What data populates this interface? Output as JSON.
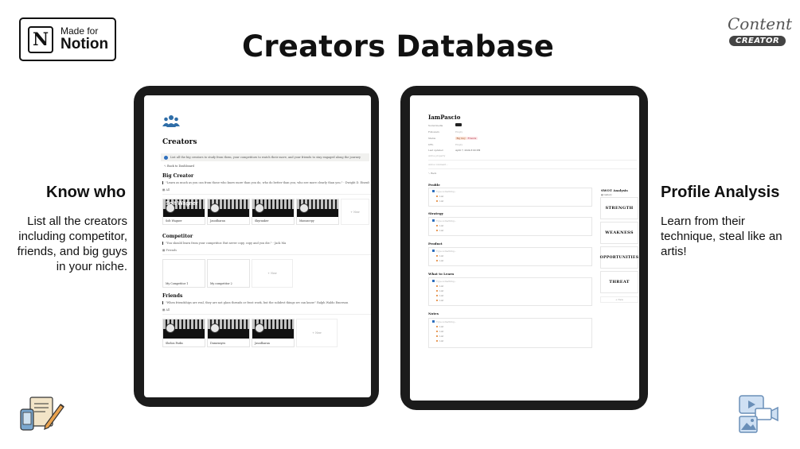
{
  "badge": {
    "small": "Made for",
    "big": "Notion",
    "logo_letter": "N"
  },
  "title": "Creators Database",
  "brand": {
    "script": "Content",
    "pill": "CREATOR"
  },
  "left_panel": {
    "heading": "Know who",
    "description": "List all the creators including competitor, friends, and big guys in your niche."
  },
  "right_panel": {
    "heading": "Profile Analysis",
    "description": "Learn from their technique, steal like an artis!"
  },
  "screen1": {
    "page_icon": "people-icon",
    "title": "Creators",
    "callout": "List all the big creators to study from them, your competitors to watch their move, and your friends to stay engaged along the journey",
    "back_link": "Back to Dashboard",
    "sections": [
      {
        "title": "Big Creator",
        "quote": "\"Learn as much as you can from those who know more than you do, who do better than you, who see more clearly than you.\" - Dwight D. Eisenhower",
        "view": "All",
        "cards": [
          "Solt Wagner",
          "Jasodharan",
          "Skyranker",
          "Manuscrpy"
        ],
        "card_overlay": "Solt Wagner",
        "new_label": "+ New"
      },
      {
        "title": "Competitor",
        "quote": "\"You should learn from your competitor. But never copy, copy and you die.\" - Jack Ma",
        "view": "Friends",
        "cards": [
          "My Competitor 1",
          "My competitor 2"
        ],
        "new_label": "+ New"
      },
      {
        "title": "Friends",
        "quote": "\"When friendships are real, they are not glass threads or frost work, but the solidest things we can know.\" Ralph Waldo Emerson",
        "view": "All",
        "cards": [
          "Shelon Parks",
          "Dumensyes",
          "Jasodharan"
        ],
        "new_label": "+ New"
      }
    ]
  },
  "screen2": {
    "title": "IamPascio",
    "properties": [
      {
        "label": "Social media",
        "value": ""
      },
      {
        "label": "Followers",
        "value": "Empty"
      },
      {
        "label": "Status",
        "value": ""
      },
      {
        "label": "URL",
        "value": "Empty"
      },
      {
        "label": "Last updated",
        "value": "April 7, 2024 8:00 PM"
      },
      {
        "label": "Add a property",
        "value": ""
      }
    ],
    "status_tags": [
      "Big Guy",
      "Friends"
    ],
    "comment": "Add a comment...",
    "back": "Back",
    "sections": [
      {
        "title": "Profile",
        "placeholder": "Type something...",
        "items": [
          "List",
          "List"
        ]
      },
      {
        "title": "Strategy",
        "placeholder": "Type something...",
        "items": [
          "List",
          "List"
        ]
      },
      {
        "title": "Product",
        "placeholder": "Type something...",
        "items": [
          "List",
          "List"
        ]
      },
      {
        "title": "What to Learn",
        "placeholder": "Type something...",
        "items": [
          "List",
          "List",
          "List",
          "List"
        ]
      },
      {
        "title": "Notes",
        "placeholder": "Type something...",
        "items": [
          "List",
          "List",
          "List",
          "List"
        ]
      }
    ],
    "swot": {
      "title": "SWOT Analysis",
      "view": "Gallery",
      "cards": [
        "STRENGTH",
        "WEAKNESS",
        "OPPORTUNITIES",
        "THREAT"
      ],
      "new_label": "+ New"
    }
  },
  "decor": {
    "left": "document-pen-illustration",
    "right": "media-gallery-illustration"
  }
}
